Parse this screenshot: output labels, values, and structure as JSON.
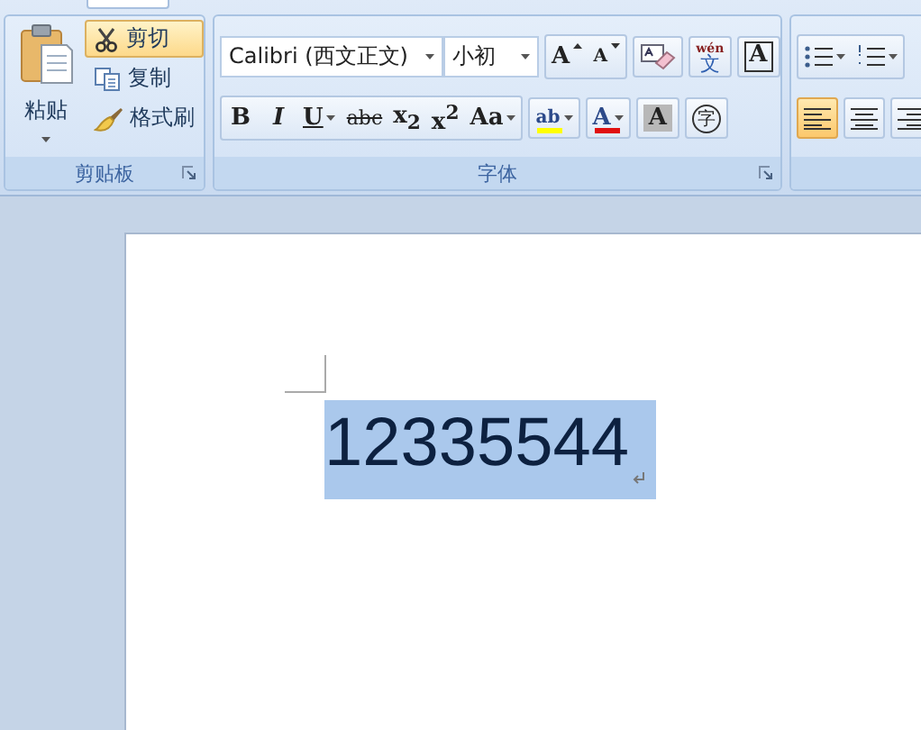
{
  "ribbon": {
    "groups": [
      {
        "kind": "clipboard",
        "title": "剪贴板",
        "paste": {
          "label": "粘贴"
        },
        "items": [
          {
            "kind": "cut",
            "label": "剪切",
            "selected": true
          },
          {
            "kind": "copy",
            "label": "复制",
            "selected": false
          },
          {
            "kind": "brush",
            "label": "格式刷",
            "selected": false
          }
        ]
      },
      {
        "kind": "font",
        "title": "字体",
        "font_name": "Calibri (西文正文)",
        "font_size": "小初",
        "row_1": [
          {
            "kind": "grow",
            "label": "A"
          },
          {
            "kind": "shrink",
            "label": "A"
          },
          {
            "kind": "clear"
          },
          {
            "kind": "phonetic",
            "ruby": "wén",
            "label": "文"
          },
          {
            "kind": "border",
            "label": "A"
          }
        ],
        "row_2": [
          {
            "kind": "bold",
            "label": "B"
          },
          {
            "kind": "italic",
            "label": "I"
          },
          {
            "kind": "underline",
            "label": "U",
            "dropdown": true
          },
          {
            "kind": "strike",
            "label": "abc"
          },
          {
            "kind": "text",
            "label": "x$_{2}$"
          },
          {
            "kind": "text",
            "label": "x$^{2}$"
          },
          {
            "kind": "text",
            "label": "Aa",
            "dropdown": true
          },
          {
            "kind": "highlight",
            "label": "ab",
            "dropdown": true
          },
          {
            "kind": "color",
            "label": "A",
            "dropdown": true
          },
          {
            "kind": "shade",
            "label": "A"
          },
          {
            "kind": "enclose",
            "label": "字"
          }
        ]
      },
      {
        "kind": "paragraph",
        "row_1": [
          {
            "kind": "bullets",
            "dropdown": true
          },
          {
            "kind": "numbering",
            "dropdown": true
          }
        ],
        "row_2": [
          {
            "kind": "align-left",
            "selected": true
          },
          {
            "kind": "align-center",
            "selected": false
          },
          {
            "kind": "align-right",
            "selected": false
          }
        ]
      }
    ]
  },
  "document": {
    "text": "12335544",
    "selected": true
  }
}
